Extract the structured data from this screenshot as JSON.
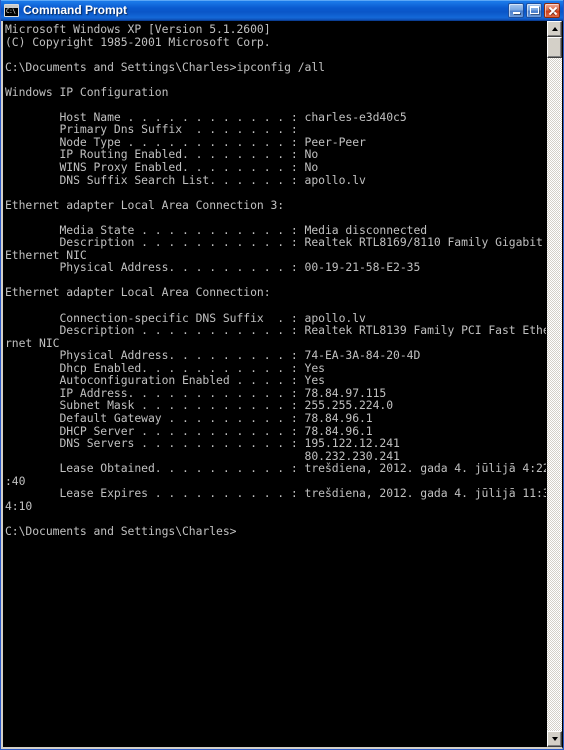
{
  "window": {
    "title": "Command Prompt",
    "icon": "console-icon",
    "icon_text": "C:\\",
    "buttons": {
      "minimize": "Minimize",
      "maximize": "Maximize",
      "close": "Close"
    },
    "colors": {
      "titlebar_blue": "#0a5bd0",
      "console_bg": "#000000",
      "console_fg": "#c0c0c0",
      "chrome_face": "#d4d0c8",
      "close_red": "#cc3d18"
    }
  },
  "scrollbar": {
    "up_arrow": "scroll-up-arrow",
    "down_arrow": "scroll-down-arrow",
    "thumb": "scroll-thumb"
  },
  "console": {
    "lines": [
      "Microsoft Windows XP [Version 5.1.2600]",
      "(C) Copyright 1985-2001 Microsoft Corp.",
      "",
      "C:\\Documents and Settings\\Charles>ipconfig /all",
      "",
      "Windows IP Configuration",
      "",
      "        Host Name . . . . . . . . . . . . : charles-e3d40c5",
      "        Primary Dns Suffix  . . . . . . . :",
      "        Node Type . . . . . . . . . . . . : Peer-Peer",
      "        IP Routing Enabled. . . . . . . . : No",
      "        WINS Proxy Enabled. . . . . . . . : No",
      "        DNS Suffix Search List. . . . . . : apollo.lv",
      "",
      "Ethernet adapter Local Area Connection 3:",
      "",
      "        Media State . . . . . . . . . . . : Media disconnected",
      "        Description . . . . . . . . . . . : Realtek RTL8169/8110 Family Gigabit",
      "Ethernet NIC",
      "        Physical Address. . . . . . . . . : 00-19-21-58-E2-35",
      "",
      "Ethernet adapter Local Area Connection:",
      "",
      "        Connection-specific DNS Suffix  . : apollo.lv",
      "        Description . . . . . . . . . . . : Realtek RTL8139 Family PCI Fast Ethe",
      "rnet NIC",
      "        Physical Address. . . . . . . . . : 74-EA-3A-84-20-4D",
      "        Dhcp Enabled. . . . . . . . . . . : Yes",
      "        Autoconfiguration Enabled . . . . : Yes",
      "        IP Address. . . . . . . . . . . . : 78.84.97.115",
      "        Subnet Mask . . . . . . . . . . . : 255.255.224.0",
      "        Default Gateway . . . . . . . . . : 78.84.96.1",
      "        DHCP Server . . . . . . . . . . . : 78.84.96.1",
      "        DNS Servers . . . . . . . . . . . : 195.122.12.241",
      "                                            80.232.230.241",
      "        Lease Obtained. . . . . . . . . . : trešdiena, 2012. gada 4. jūlijā 4:22",
      ":40",
      "        Lease Expires . . . . . . . . . . : trešdiena, 2012. gada 4. jūlijā 11:3",
      "4:10",
      "",
      "C:\\Documents and Settings\\Charles>"
    ]
  }
}
